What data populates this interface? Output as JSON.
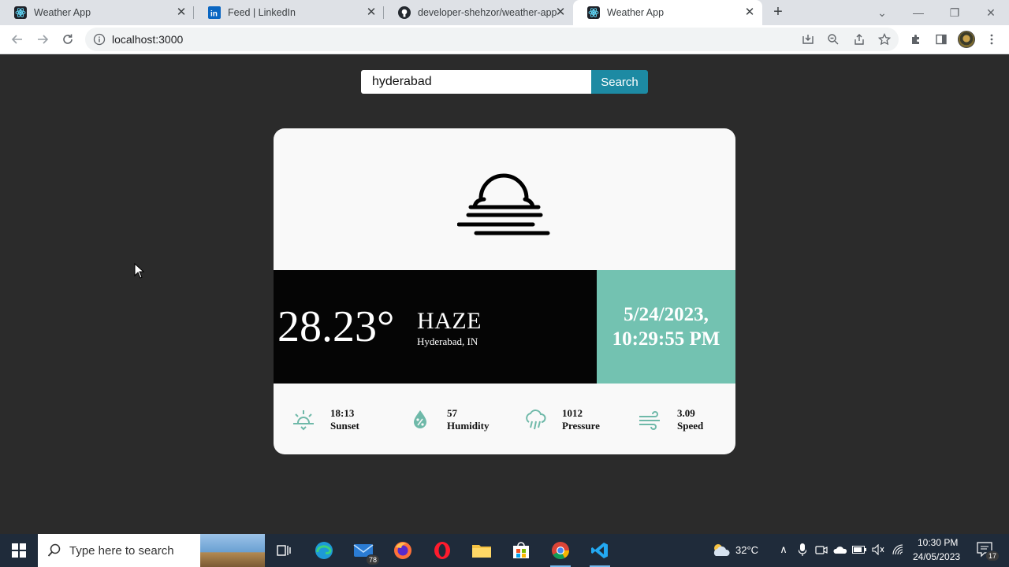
{
  "browser": {
    "tabs": [
      {
        "label": "Weather App",
        "favicon": "react-icon",
        "active": false
      },
      {
        "label": "Feed | LinkedIn",
        "favicon": "linkedin-icon",
        "active": false
      },
      {
        "label": "developer-shehzor/weather-app",
        "favicon": "github-icon",
        "active": false
      },
      {
        "label": "Weather App",
        "favicon": "react-icon",
        "active": true
      }
    ],
    "url": "localhost:3000"
  },
  "search": {
    "value": "hyderabad",
    "button_label": "Search"
  },
  "weather": {
    "icon": "haze-icon",
    "temperature": "28.23°",
    "condition": "HAZE",
    "location": "Hyderabad, IN",
    "date": "5/24/2023,",
    "time": "10:29:55 PM",
    "stats": [
      {
        "icon": "sunset-icon",
        "value": "18:13",
        "label": "Sunset"
      },
      {
        "icon": "humidity-icon",
        "value": "57",
        "label": "Humidity"
      },
      {
        "icon": "pressure-icon",
        "value": "1012",
        "label": "Pressure"
      },
      {
        "icon": "wind-icon",
        "value": "3.09",
        "label": "Speed"
      }
    ],
    "colors": {
      "accent": "#73c2b1",
      "button": "#1d8aa3",
      "band": "#050505",
      "page": "#2b2b2b",
      "card": "#f9f9f9"
    }
  },
  "taskbar": {
    "search_placeholder": "Type here to search",
    "mail_badge": "78",
    "weather": "32°C",
    "time": "10:30 PM",
    "date": "24/05/2023",
    "notifications": "17"
  }
}
